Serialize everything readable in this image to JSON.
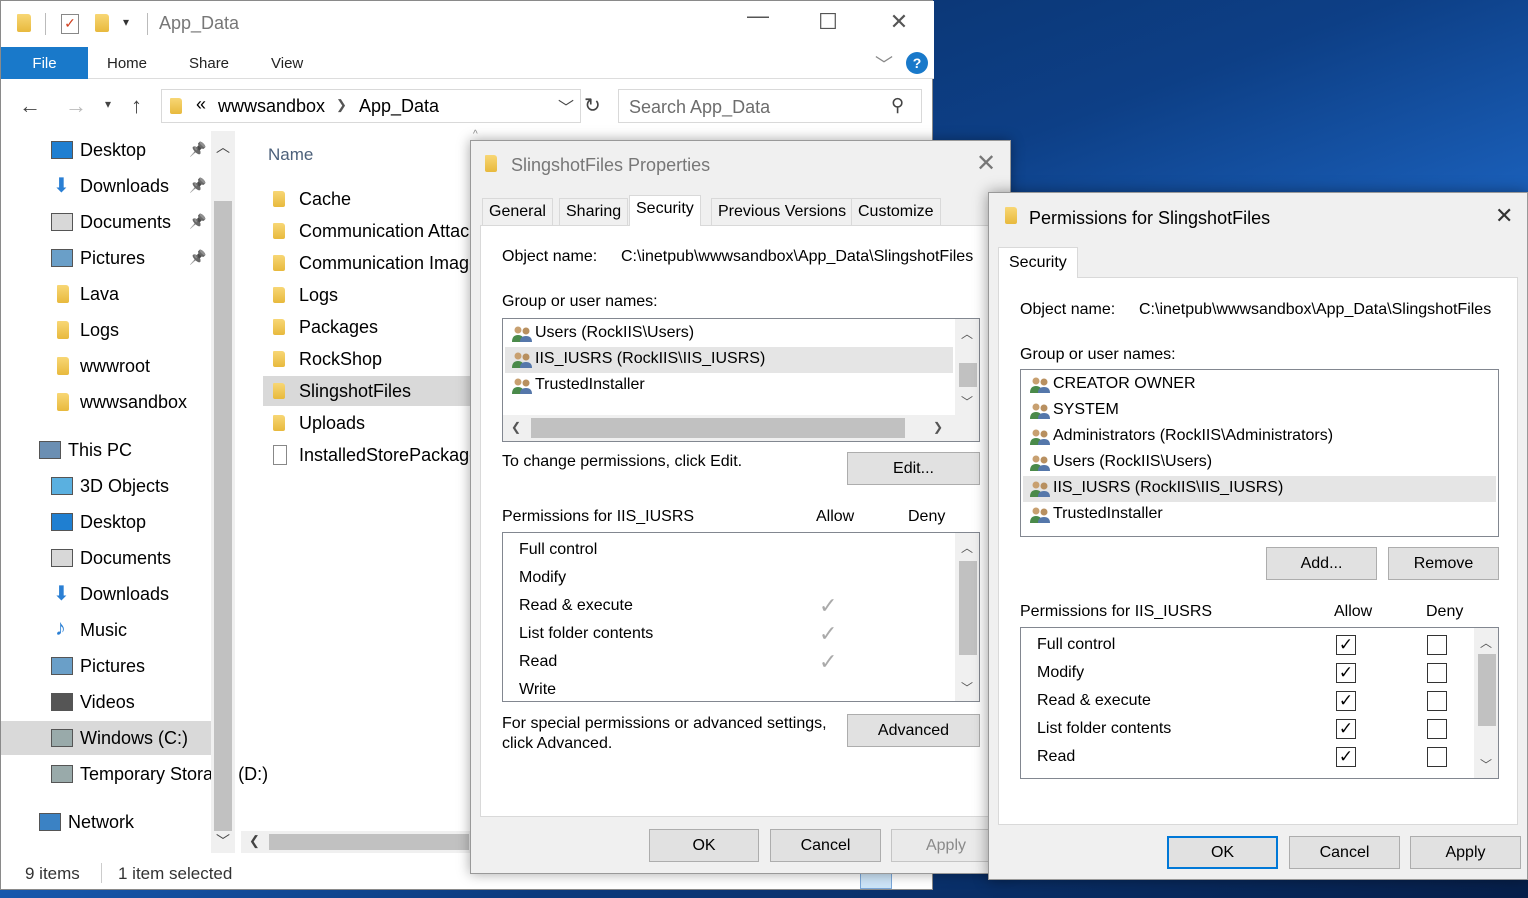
{
  "explorer": {
    "title": "App_Data",
    "ribbon_tabs": [
      "File",
      "Home",
      "Share",
      "View"
    ],
    "help": "?",
    "address": {
      "prefix": "«",
      "path": [
        "wwwsandbox",
        "App_Data"
      ]
    },
    "search_placeholder": "Search App_Data",
    "column_name": "Name",
    "nav_items": [
      {
        "label": "Desktop",
        "icon": "desktop-icon",
        "pinned": true
      },
      {
        "label": "Downloads",
        "icon": "download-icon",
        "pinned": true
      },
      {
        "label": "Documents",
        "icon": "documents-icon",
        "pinned": true
      },
      {
        "label": "Pictures",
        "icon": "pictures-icon",
        "pinned": true
      },
      {
        "label": "Lava",
        "icon": "folder-icon"
      },
      {
        "label": "Logs",
        "icon": "folder-icon"
      },
      {
        "label": "wwwroot",
        "icon": "folder-icon"
      },
      {
        "label": "wwwsandbox",
        "icon": "folder-icon"
      },
      {
        "label": "This PC",
        "icon": "pc-icon"
      },
      {
        "label": "3D Objects",
        "icon": "3d-objects-icon"
      },
      {
        "label": "Desktop",
        "icon": "desktop-icon"
      },
      {
        "label": "Documents",
        "icon": "documents-icon"
      },
      {
        "label": "Downloads",
        "icon": "download-icon"
      },
      {
        "label": "Music",
        "icon": "music-icon"
      },
      {
        "label": "Pictures",
        "icon": "pictures-icon"
      },
      {
        "label": "Videos",
        "icon": "videos-icon"
      },
      {
        "label": "Windows (C:)",
        "icon": "drive-icon",
        "selected": true
      },
      {
        "label": "Temporary Storage (D:)",
        "icon": "drive-icon"
      },
      {
        "label": "Network",
        "icon": "network-icon"
      }
    ],
    "files": [
      {
        "label": "Cache",
        "type": "folder"
      },
      {
        "label": "Communication Attachments",
        "type": "folder"
      },
      {
        "label": "Communication Images",
        "type": "folder"
      },
      {
        "label": "Logs",
        "type": "folder"
      },
      {
        "label": "Packages",
        "type": "folder"
      },
      {
        "label": "RockShop",
        "type": "folder"
      },
      {
        "label": "SlingshotFiles",
        "type": "folder",
        "selected": true
      },
      {
        "label": "Uploads",
        "type": "folder"
      },
      {
        "label": "InstalledStorePackages.json",
        "type": "file"
      }
    ],
    "status": {
      "items": "9 items",
      "selected": "1 item selected"
    }
  },
  "properties": {
    "title": "SlingshotFiles Properties",
    "tabs": [
      "General",
      "Sharing",
      "Security",
      "Previous Versions",
      "Customize"
    ],
    "object_label": "Object name:",
    "object_value": "C:\\inetpub\\wwwsandbox\\App_Data\\SlingshotFiles",
    "group_label": "Group or user names:",
    "users": [
      "Users (RockIIS\\Users)",
      "IIS_IUSRS (RockIIS\\IIS_IUSRS)",
      "TrustedInstaller"
    ],
    "change_text": "To change permissions, click Edit.",
    "edit_button": "Edit...",
    "perm_header": "Permissions for IIS_IUSRS",
    "allow": "Allow",
    "deny": "Deny",
    "permissions": [
      {
        "label": "Full control",
        "allow": false
      },
      {
        "label": "Modify",
        "allow": false
      },
      {
        "label": "Read & execute",
        "allow": true
      },
      {
        "label": "List folder contents",
        "allow": true
      },
      {
        "label": "Read",
        "allow": true
      },
      {
        "label": "Write",
        "allow": false
      }
    ],
    "special_text_1": "For special permissions or advanced settings,",
    "special_text_2": "click Advanced.",
    "advanced_button": "Advanced",
    "ok": "OK",
    "cancel": "Cancel",
    "apply": "Apply"
  },
  "permissions_dialog": {
    "title": "Permissions for SlingshotFiles",
    "tab": "Security",
    "object_label": "Object name:",
    "object_value": "C:\\inetpub\\wwwsandbox\\App_Data\\SlingshotFiles",
    "group_label": "Group or user names:",
    "users": [
      "CREATOR OWNER",
      "SYSTEM",
      "Administrators (RockIIS\\Administrators)",
      "Users (RockIIS\\Users)",
      "IIS_IUSRS (RockIIS\\IIS_IUSRS)",
      "TrustedInstaller"
    ],
    "add_button": "Add...",
    "remove_button": "Remove",
    "perm_header": "Permissions for IIS_IUSRS",
    "allow": "Allow",
    "deny": "Deny",
    "permissions": [
      {
        "label": "Full control",
        "allow": true,
        "deny": false
      },
      {
        "label": "Modify",
        "allow": true,
        "deny": false
      },
      {
        "label": "Read & execute",
        "allow": true,
        "deny": false
      },
      {
        "label": "List folder contents",
        "allow": true,
        "deny": false
      },
      {
        "label": "Read",
        "allow": true,
        "deny": false
      }
    ],
    "ok": "OK",
    "cancel": "Cancel",
    "apply": "Apply"
  }
}
